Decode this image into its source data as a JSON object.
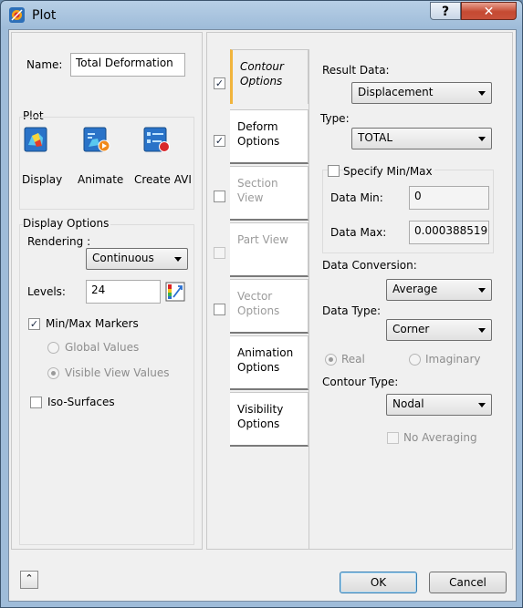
{
  "window": {
    "title": "Plot",
    "help_label": "?",
    "close_label": "✕"
  },
  "left": {
    "name_label": "Name:",
    "name_value": "Total Deformation",
    "plot_group_label": "Plot",
    "plot_buttons": [
      {
        "label": "Display",
        "icon": "display-icon"
      },
      {
        "label": "Animate",
        "icon": "animate-icon"
      },
      {
        "label": "Create AVI",
        "icon": "create-avi-icon"
      }
    ],
    "display_options_label": "Display Options",
    "rendering_label": "Rendering :",
    "rendering_value": "Continuous",
    "levels_label": "Levels:",
    "levels_value": "24",
    "minmax_markers_label": "Min/Max Markers",
    "minmax_markers_checked": true,
    "global_values_label": "Global Values",
    "visible_view_values_label": "Visible View Values",
    "selected_value_mode": "Visible View Values",
    "iso_surfaces_label": "Iso-Surfaces",
    "iso_surfaces_checked": false
  },
  "tabs": [
    {
      "label1": "Contour",
      "label2": "Options",
      "checked": true,
      "active": true,
      "enabled": true
    },
    {
      "label1": "Deform",
      "label2": "Options",
      "checked": true,
      "active": false,
      "enabled": true
    },
    {
      "label1": "Section View",
      "label2": "",
      "checked": false,
      "active": false,
      "enabled": false
    },
    {
      "label1": "Part View",
      "label2": "",
      "checked": false,
      "active": false,
      "enabled": false
    },
    {
      "label1": "Vector",
      "label2": "Options",
      "checked": false,
      "active": false,
      "enabled": false
    },
    {
      "label1": "Animation",
      "label2": "Options",
      "active": false,
      "enabled": true
    },
    {
      "label1": "Visibility",
      "label2": "Options",
      "active": false,
      "enabled": true
    }
  ],
  "contour": {
    "result_data_label": "Result Data:",
    "result_data_value": "Displacement",
    "type_label": "Type:",
    "type_value": "TOTAL",
    "specify_minmax_label": "Specify Min/Max",
    "specify_minmax_checked": false,
    "data_min_label": "Data Min:",
    "data_min_value": "0",
    "data_max_label": "Data Max:",
    "data_max_value": "0.000388519",
    "data_conversion_label": "Data Conversion:",
    "data_conversion_value": "Average",
    "data_type_label": "Data Type:",
    "data_type_value": "Corner",
    "real_label": "Real",
    "imaginary_label": "Imaginary",
    "selected_number_mode": "Real",
    "contour_type_label": "Contour Type:",
    "contour_type_value": "Nodal",
    "no_averaging_label": "No Averaging",
    "no_averaging_checked": false
  },
  "footer": {
    "collapse_icon": "double-chevron-up-icon",
    "ok_label": "OK",
    "cancel_label": "Cancel"
  },
  "colors": {
    "accent_tab": "#f1b43c",
    "title_bg": "#9fbcd9",
    "close_red": "#c54a32"
  }
}
